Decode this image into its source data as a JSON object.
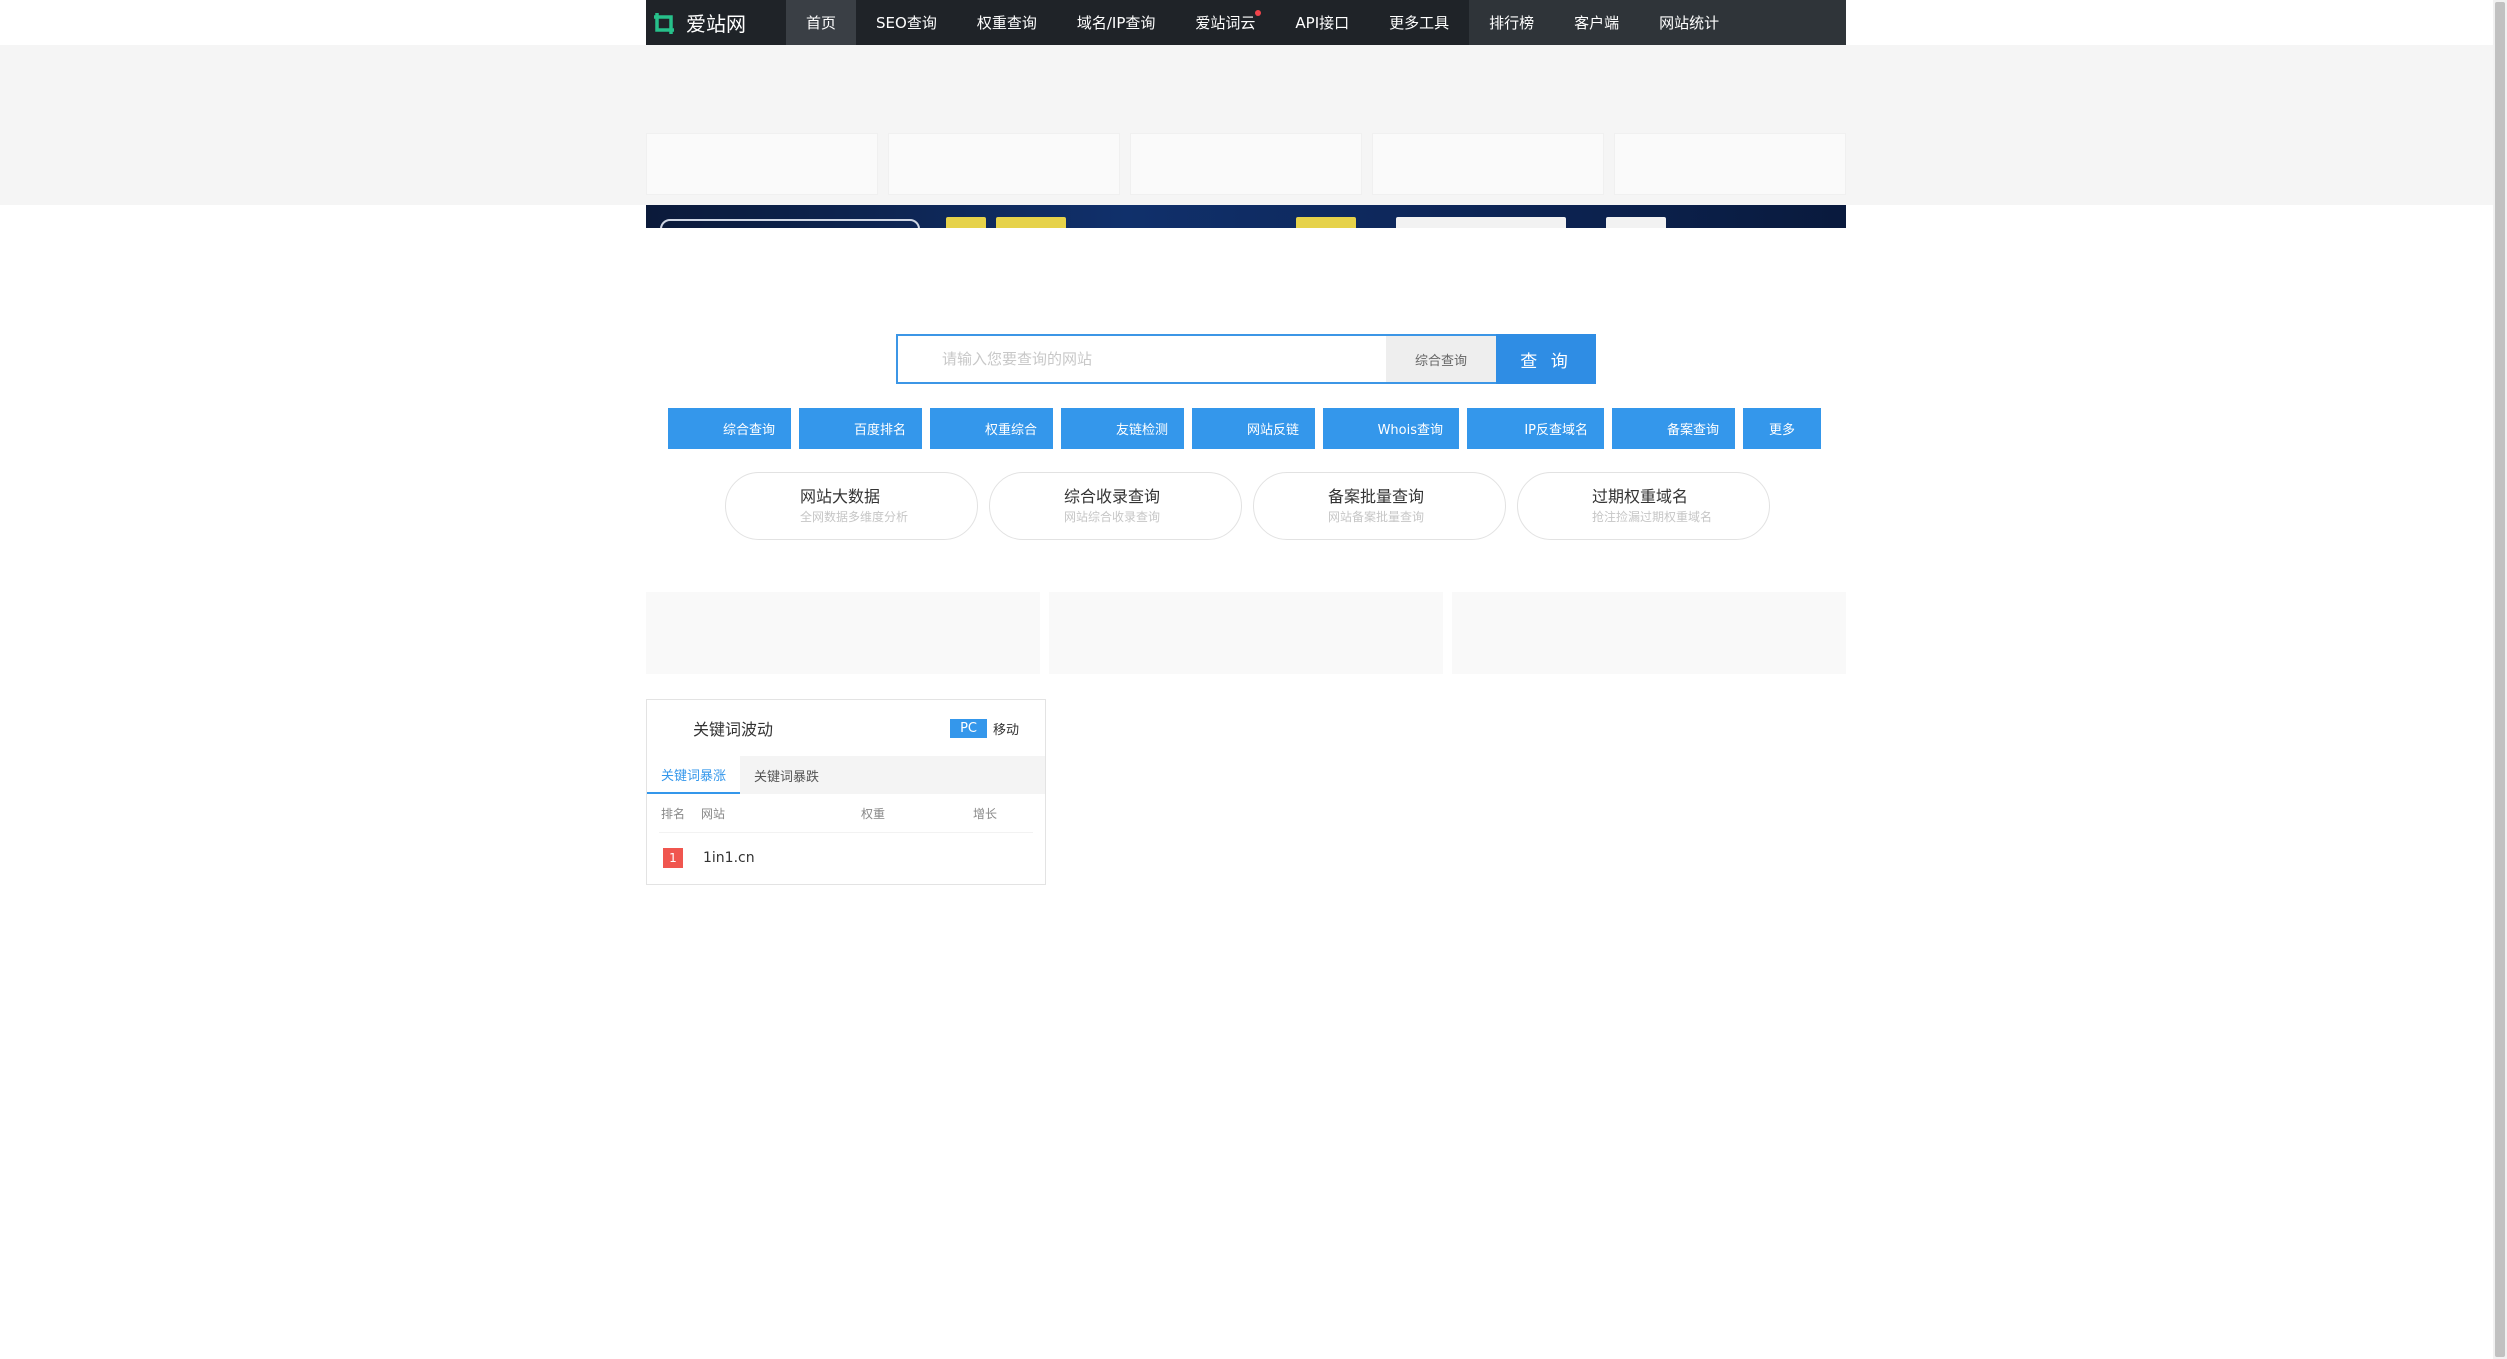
{
  "nav": {
    "logo_text": "爱站网",
    "items": [
      {
        "label": "首页"
      },
      {
        "label": "SEO查询"
      },
      {
        "label": "权重查询"
      },
      {
        "label": "域名/IP查询"
      },
      {
        "label": "爱站词云"
      },
      {
        "label": "API接口"
      },
      {
        "label": "更多工具"
      },
      {
        "label": "排行榜"
      },
      {
        "label": "客户端"
      },
      {
        "label": "网站统计"
      }
    ]
  },
  "search": {
    "placeholder": "请输入您要查询的网站",
    "select_value": "综合查询",
    "button_label": "查 询"
  },
  "quick_buttons": [
    {
      "label": "综合查询"
    },
    {
      "label": "百度排名"
    },
    {
      "label": "权重综合"
    },
    {
      "label": "友链检测"
    },
    {
      "label": "网站反链"
    },
    {
      "label": "Whois查询"
    },
    {
      "label": "IP反查域名"
    },
    {
      "label": "备案查询"
    },
    {
      "label": "更多"
    }
  ],
  "pills": [
    {
      "title": "网站大数据",
      "subtitle": "全网数据多维度分析"
    },
    {
      "title": "综合收录查询",
      "subtitle": "网站综合收录查询"
    },
    {
      "title": "备案批量查询",
      "subtitle": "网站备案批量查询"
    },
    {
      "title": "过期权重域名",
      "subtitle": "抢注捡漏过期权重域名"
    }
  ],
  "keyword_panel": {
    "title": "关键词波动",
    "switch_pc": "PC",
    "switch_mobile": "移动",
    "tabs": [
      {
        "label": "关键词暴涨"
      },
      {
        "label": "关键词暴跌"
      }
    ],
    "columns": {
      "rank": "排名",
      "site": "网站",
      "weight": "权重",
      "growth": "增长"
    },
    "rows": [
      {
        "rank": "1",
        "site": "1in1.cn"
      }
    ]
  },
  "colors": {
    "nav_bg": "#1f2328",
    "accent": "#3497eb",
    "rank_red": "#f0564f"
  }
}
